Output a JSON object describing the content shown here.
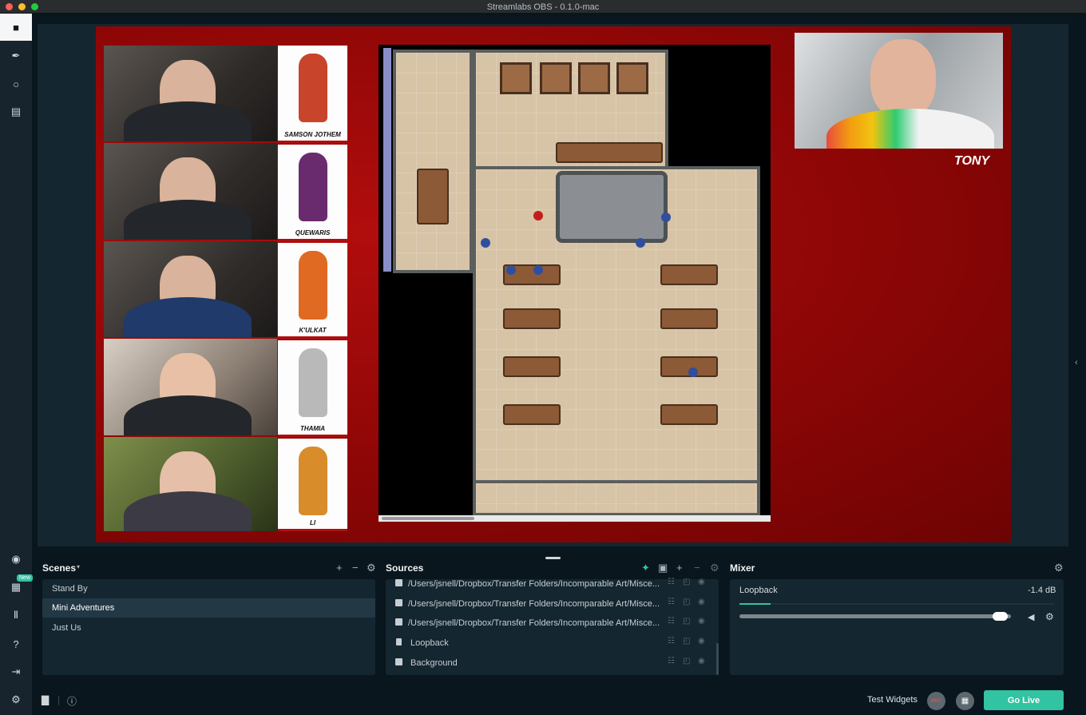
{
  "window": {
    "title": "Streamlabs OBS - 0.1.0-mac"
  },
  "nav": {
    "new_badge": "New",
    "items": [
      {
        "name": "editor",
        "icon": "camera-icon",
        "glyph": "■"
      },
      {
        "name": "themes",
        "icon": "brush-icon",
        "glyph": "✒"
      },
      {
        "name": "dashboard",
        "icon": "chat-icon",
        "glyph": "○"
      },
      {
        "name": "store",
        "icon": "store-icon",
        "glyph": "▤"
      },
      {
        "name": "studio-mode",
        "icon": "compass-icon",
        "glyph": "◉"
      },
      {
        "name": "layout",
        "icon": "grid-icon",
        "glyph": "▦"
      },
      {
        "name": "columns",
        "icon": "columns-icon",
        "glyph": "Ⅱ"
      },
      {
        "name": "help",
        "icon": "help-icon",
        "glyph": "?"
      },
      {
        "name": "logout",
        "icon": "logout-icon",
        "glyph": "⇥"
      },
      {
        "name": "settings",
        "icon": "gear-icon",
        "glyph": "⚙"
      }
    ]
  },
  "preview": {
    "cards": [
      "SAMSON JOTHEM",
      "QUEWARIS",
      "K'ULKAT",
      "THAMIA",
      "LI"
    ],
    "host_label": "TONY"
  },
  "scenes": {
    "title": "Scenes",
    "items": [
      "Stand By",
      "Mini Adventures",
      "Just Us"
    ],
    "selected": "Mini Adventures"
  },
  "sources": {
    "title": "Sources",
    "items": [
      {
        "label": "/Users/jsnell/Dropbox/Transfer Folders/Incomparable Art/Misce...",
        "type": "image"
      },
      {
        "label": "/Users/jsnell/Dropbox/Transfer Folders/Incomparable Art/Misce...",
        "type": "image"
      },
      {
        "label": "/Users/jsnell/Dropbox/Transfer Folders/Incomparable Art/Misce...",
        "type": "image"
      },
      {
        "label": "Loopback",
        "type": "file"
      },
      {
        "label": "Background",
        "type": "image"
      }
    ]
  },
  "mixer": {
    "title": "Mixer",
    "source_name": "Loopback",
    "level_db": "-1.4 dB",
    "volume_fraction": 0.98,
    "meter_fraction": 0.1
  },
  "footer": {
    "test_widgets": "Test Widgets",
    "rec": "REC",
    "go_live": "Go Live"
  },
  "colors": {
    "accent": "#31c3a2",
    "background": "#09161d",
    "panel": "#142630"
  }
}
